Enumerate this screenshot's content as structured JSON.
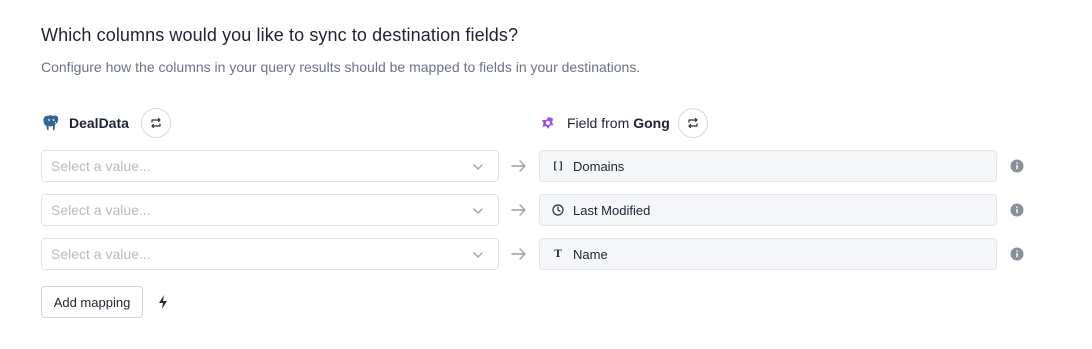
{
  "heading": {
    "title": "Which columns would you like to sync to destination fields?",
    "subtitle": "Configure how the columns in your query results should be mapped to fields in your destinations."
  },
  "source": {
    "name": "DealData",
    "icon": "postgres-elephant-icon",
    "swap_icon": "swap-icon"
  },
  "destination": {
    "prefix": "Field from",
    "name": "Gong",
    "icon": "gong-logo-icon",
    "accent_color": "#a14cf0",
    "swap_icon": "swap-icon"
  },
  "mappings": [
    {
      "placeholder": "Select a value...",
      "field_icon": "array-brackets-icon",
      "field_icon_text": "[]",
      "field_label": "Domains"
    },
    {
      "placeholder": "Select a value...",
      "field_icon": "clock-icon",
      "field_icon_text": "",
      "field_label": "Last Modified"
    },
    {
      "placeholder": "Select a value...",
      "field_icon": "text-type-icon",
      "field_icon_text": "T",
      "field_label": "Name"
    }
  ],
  "actions": {
    "add_mapping_label": "Add mapping",
    "bolt_icon": "lightning-bolt-icon"
  },
  "colors": {
    "text_primary": "#1e2330",
    "text_secondary": "#6b7480",
    "placeholder": "#b6bcc4",
    "field_bg": "#f4f6f8",
    "border": "#dde1e6",
    "icon_gray": "#8a9099"
  }
}
